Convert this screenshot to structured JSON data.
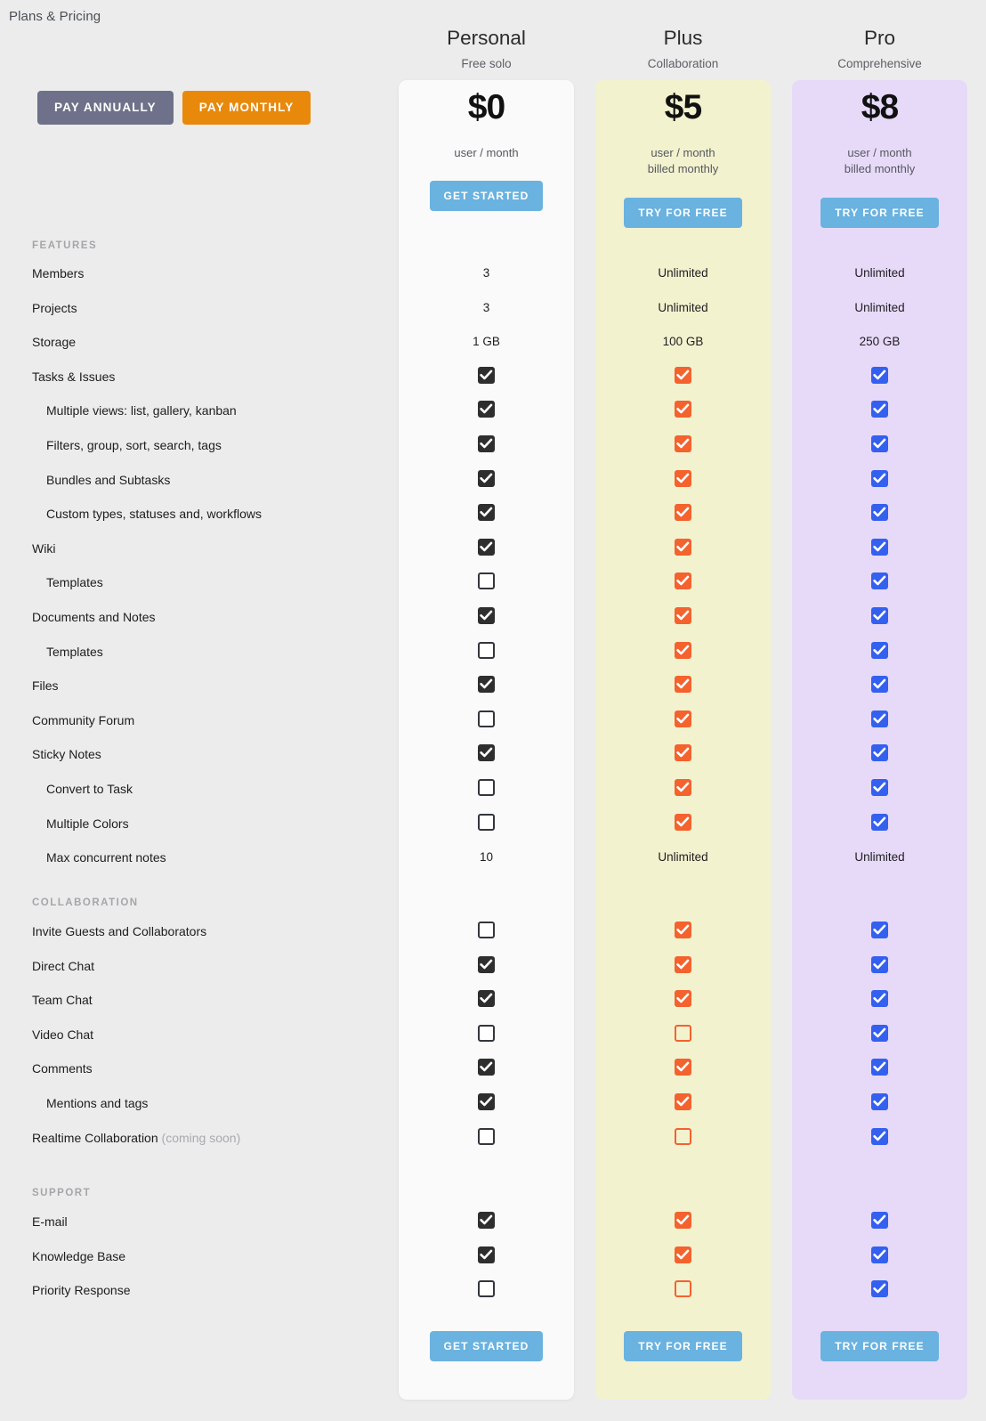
{
  "breadcrumb": "Plans & Pricing",
  "billing": {
    "annual_label": "PAY ANNUALLY",
    "monthly_label": "PAY MONTHLY",
    "active": "monthly",
    "annual_color": "#6e7189",
    "monthly_color": "#e8890c"
  },
  "plans": [
    {
      "name": "Personal",
      "tagline": "Free solo",
      "price": "$0",
      "price_note": "user / month",
      "cta": "GET STARTED",
      "card_color": "#fafafa",
      "accent": "#2e2e2e"
    },
    {
      "name": "Plus",
      "tagline": "Collaboration",
      "price": "$5",
      "price_note": "user / month\nbilled monthly",
      "cta": "TRY FOR FREE",
      "card_color": "#f3f2cf",
      "accent": "#f4622e"
    },
    {
      "name": "Pro",
      "tagline": "Comprehensive",
      "price": "$8",
      "price_note": "user / month\nbilled monthly",
      "cta": "TRY FOR FREE",
      "card_color": "#e7daf9",
      "accent": "#3460ef"
    }
  ],
  "cta_color": "#6ab2df",
  "groups": [
    {
      "title": "FEATURES",
      "rows": [
        {
          "label": "Members",
          "sub": false,
          "values": [
            "3",
            "Unlimited",
            "Unlimited"
          ]
        },
        {
          "label": "Projects",
          "sub": false,
          "values": [
            "3",
            "Unlimited",
            "Unlimited"
          ]
        },
        {
          "label": "Storage",
          "sub": false,
          "values": [
            "1 GB",
            "100 GB",
            "250 GB"
          ]
        },
        {
          "label": "Tasks & Issues",
          "sub": false,
          "values": [
            "check",
            "check",
            "check"
          ]
        },
        {
          "label": "Multiple views: list, gallery, kanban",
          "sub": true,
          "values": [
            "check",
            "check",
            "check"
          ]
        },
        {
          "label": "Filters, group, sort, search, tags",
          "sub": true,
          "values": [
            "check",
            "check",
            "check"
          ]
        },
        {
          "label": "Bundles and Subtasks",
          "sub": true,
          "values": [
            "check",
            "check",
            "check"
          ]
        },
        {
          "label": "Custom types, statuses and, workflows",
          "sub": true,
          "values": [
            "check",
            "check",
            "check"
          ]
        },
        {
          "label": "Wiki",
          "sub": false,
          "values": [
            "check",
            "check",
            "check"
          ]
        },
        {
          "label": "Templates",
          "sub": true,
          "values": [
            "uncheck",
            "check",
            "check"
          ]
        },
        {
          "label": "Documents and Notes",
          "sub": false,
          "values": [
            "check",
            "check",
            "check"
          ]
        },
        {
          "label": "Templates",
          "sub": true,
          "values": [
            "uncheck",
            "check",
            "check"
          ]
        },
        {
          "label": "Files",
          "sub": false,
          "values": [
            "check",
            "check",
            "check"
          ]
        },
        {
          "label": "Community Forum",
          "sub": false,
          "values": [
            "uncheck",
            "check",
            "check"
          ]
        },
        {
          "label": "Sticky Notes",
          "sub": false,
          "values": [
            "check",
            "check",
            "check"
          ]
        },
        {
          "label": "Convert to Task",
          "sub": true,
          "values": [
            "uncheck",
            "check",
            "check"
          ]
        },
        {
          "label": "Multiple Colors",
          "sub": true,
          "values": [
            "uncheck",
            "check",
            "check"
          ]
        },
        {
          "label": "Max concurrent notes",
          "sub": true,
          "values": [
            "10",
            "Unlimited",
            "Unlimited"
          ]
        }
      ]
    },
    {
      "title": "COLLABORATION",
      "rows": [
        {
          "label": "Invite Guests and Collaborators",
          "sub": false,
          "values": [
            "uncheck",
            "check",
            "check"
          ]
        },
        {
          "label": "Direct Chat",
          "sub": false,
          "values": [
            "check",
            "check",
            "check"
          ]
        },
        {
          "label": "Team Chat",
          "sub": false,
          "values": [
            "check",
            "check",
            "check"
          ]
        },
        {
          "label": "Video Chat",
          "sub": false,
          "values": [
            "uncheck",
            "uncheck",
            "check"
          ]
        },
        {
          "label": "Comments",
          "sub": false,
          "values": [
            "check",
            "check",
            "check"
          ]
        },
        {
          "label": "Mentions and tags",
          "sub": true,
          "values": [
            "check",
            "check",
            "check"
          ]
        },
        {
          "label": "Realtime Collaboration",
          "note": "(coming soon)",
          "sub": false,
          "values": [
            "uncheck",
            "uncheck",
            "check"
          ]
        }
      ]
    },
    {
      "title": "SUPPORT",
      "rows": [
        {
          "label": "E-mail",
          "sub": false,
          "values": [
            "check",
            "check",
            "check"
          ]
        },
        {
          "label": "Knowledge Base",
          "sub": false,
          "values": [
            "check",
            "check",
            "check"
          ]
        },
        {
          "label": "Priority Response",
          "sub": false,
          "values": [
            "uncheck",
            "uncheck",
            "check"
          ]
        }
      ]
    }
  ],
  "layout": {
    "group_tops": [
      270,
      1008,
      1334
    ],
    "row_start_tops": [
      297,
      1036,
      1362
    ],
    "row_step": 38.6
  }
}
